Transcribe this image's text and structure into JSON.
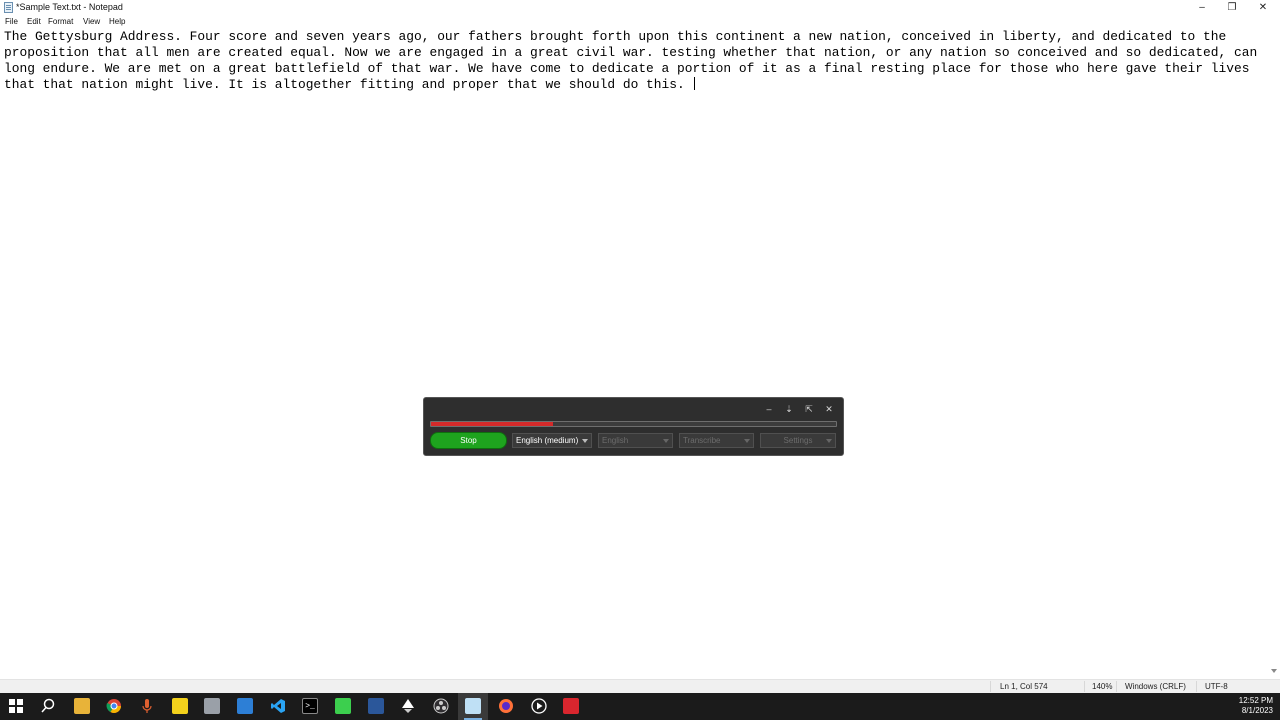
{
  "window": {
    "title": "*Sample Text.txt - Notepad",
    "controls": {
      "minimize": "–",
      "restore": "❐",
      "close": "✕"
    }
  },
  "menu": {
    "items": [
      "File",
      "Edit",
      "Format",
      "View",
      "Help"
    ]
  },
  "editor": {
    "content": "The Gettysburg Address. Four score and seven years ago, our fathers brought forth upon this continent a new nation, conceived in liberty, and dedicated to the proposition that all men are created equal. Now we are engaged in a great civil war. testing whether that nation, or any nation so conceived and so dedicated, can long endure. We are met on a great battlefield of that war. We have come to dedicate a portion of it as a final resting place for those who here gave their lives that that nation might live. It is altogether fitting and proper that we should do this. "
  },
  "statusbar": {
    "position": "Ln 1, Col 574",
    "zoom": "140%",
    "line_ending": "Windows (CRLF)",
    "encoding": "UTF-8"
  },
  "widget": {
    "buttons": {
      "minimize": "–",
      "pin": "⇣",
      "expand": "⇱",
      "close": "✕"
    },
    "recording_level": 0.3,
    "stop_label": "Stop",
    "model_select": "English (medium)",
    "language_select": "English",
    "task_select": "Transcribe",
    "settings_label": "Settings",
    "colors": {
      "stop": "#1ea31e",
      "level": "#d42a2a"
    }
  },
  "taskbar": {
    "icons": [
      "windows-start-icon",
      "search-icon",
      "file-explorer-icon",
      "chrome-icon",
      "microphone-icon",
      "sticky-notes-icon",
      "app-icon",
      "outlook-icon",
      "vscode-icon",
      "terminal-icon",
      "green-app-icon",
      "word-icon",
      "inkscape-icon",
      "obs-icon",
      "notepad-icon",
      "firefox-icon",
      "media-player-icon",
      "red-app-icon"
    ],
    "time": "12:52 PM",
    "date": "8/1/2023"
  }
}
